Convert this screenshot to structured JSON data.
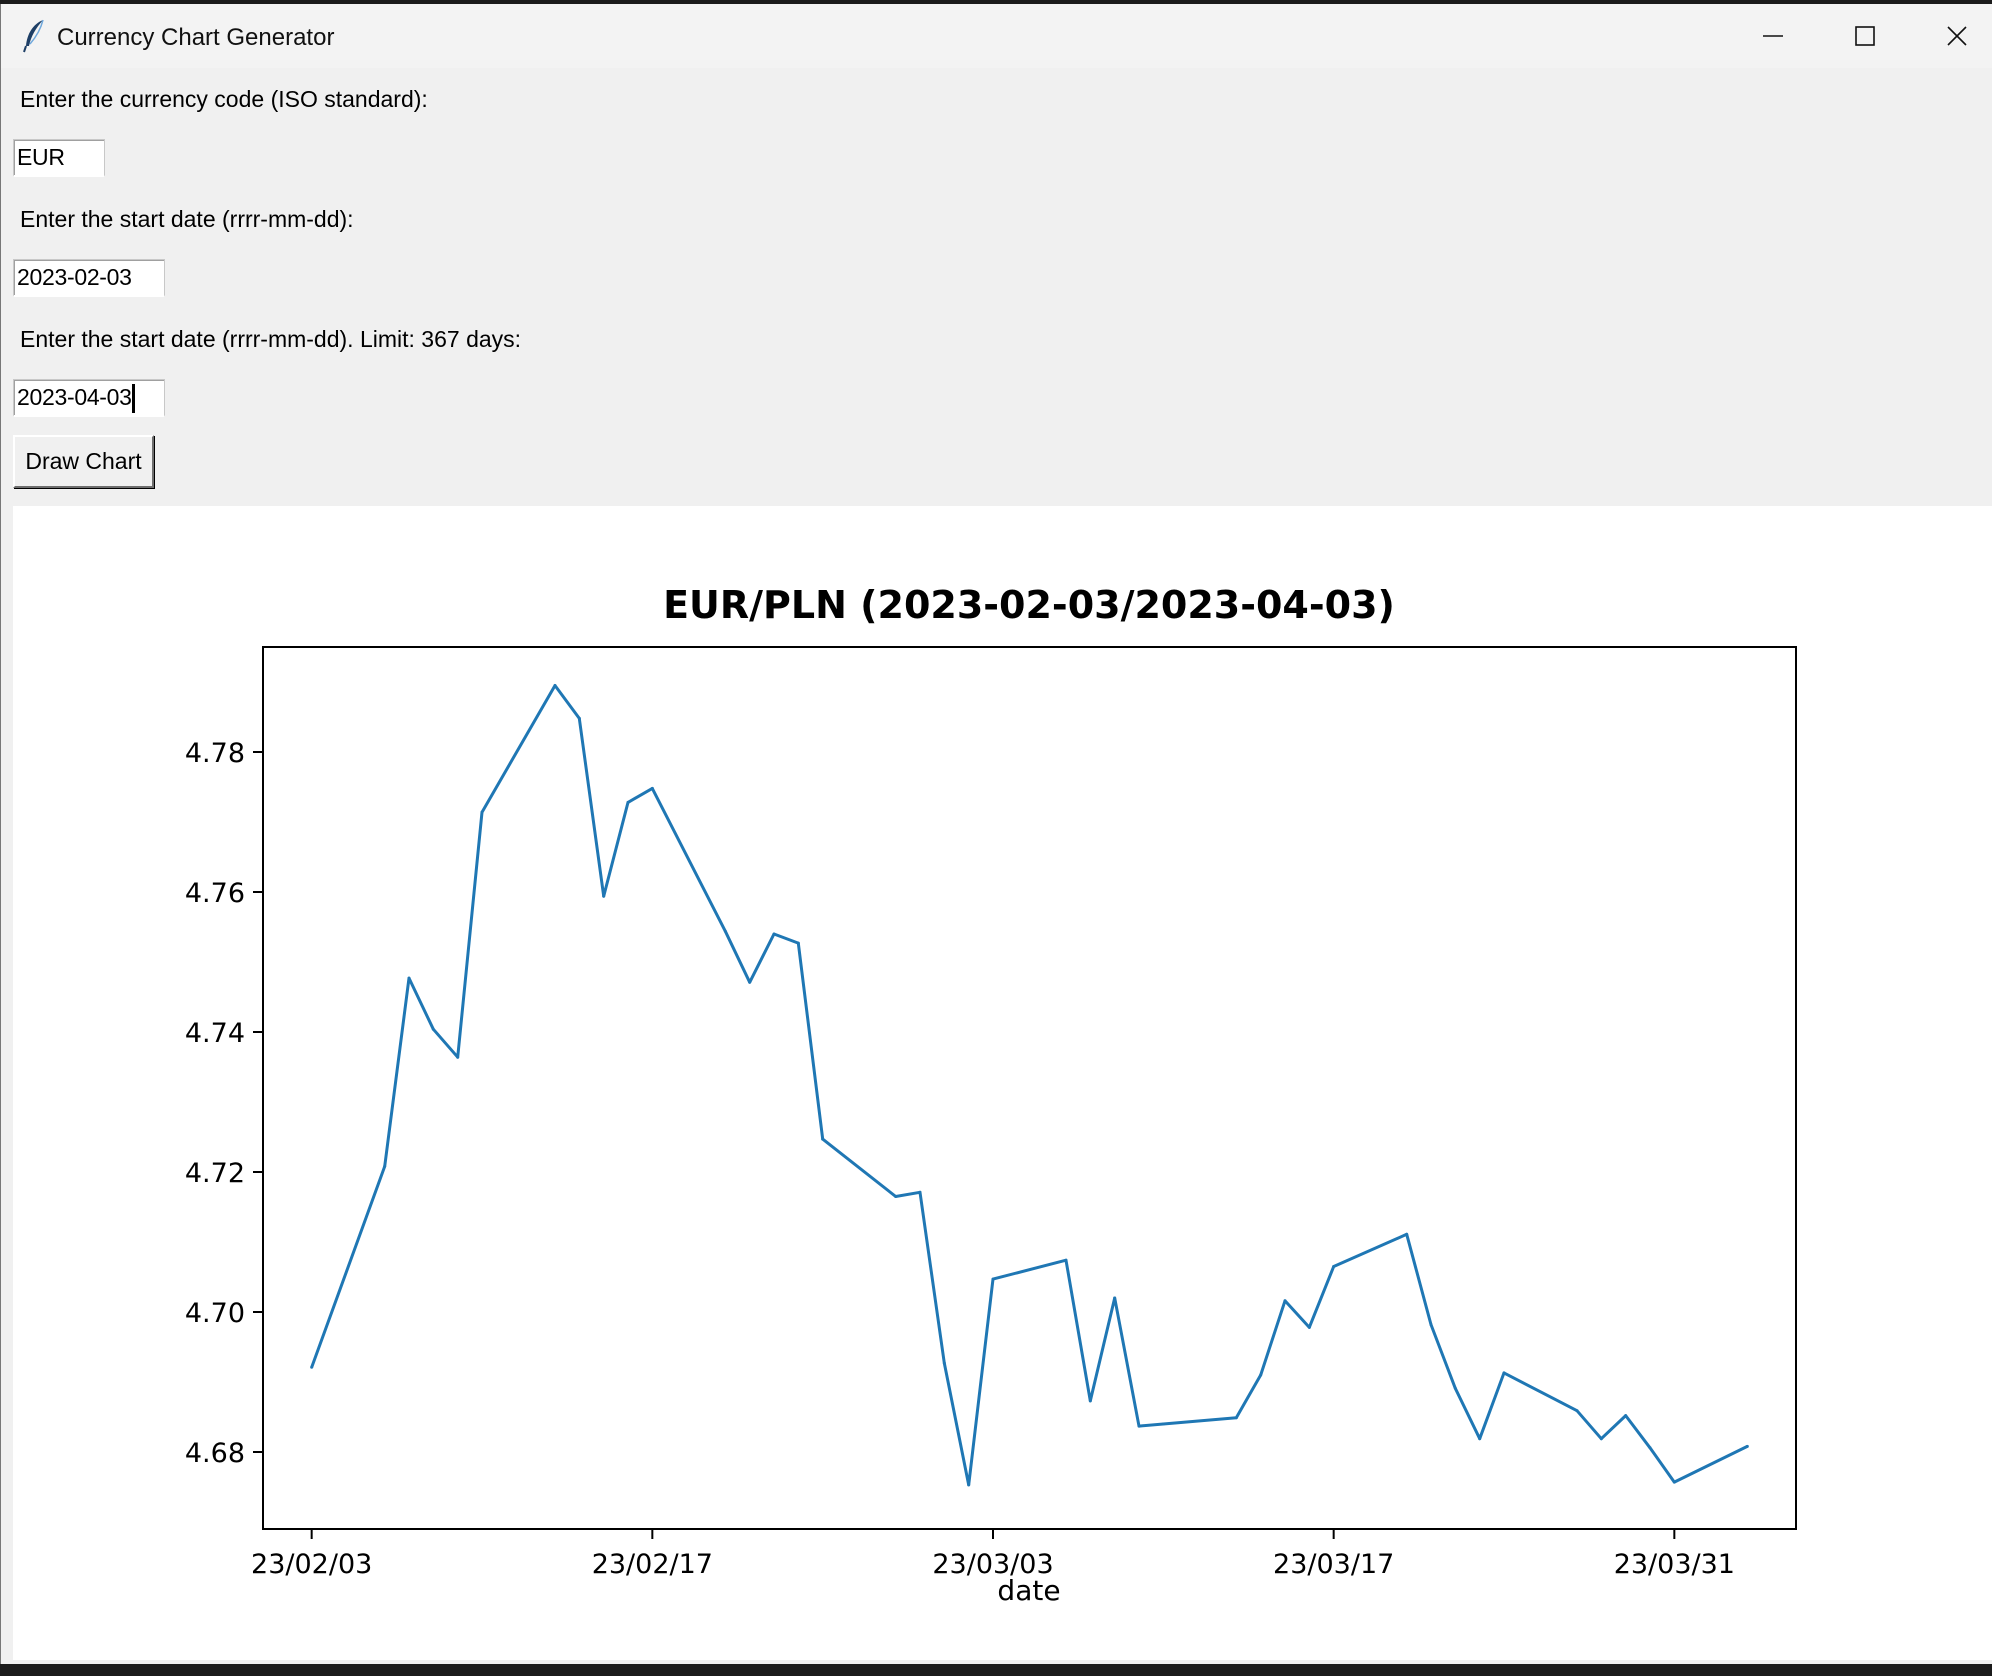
{
  "window": {
    "title": "Currency Chart Generator",
    "icon": "feather-icon",
    "controls": [
      "minimize-icon",
      "maximize-icon",
      "close-icon"
    ]
  },
  "form": {
    "currency_label": "Enter the currency code (ISO standard):",
    "currency_value": "EUR",
    "start_label": "Enter the start date (rrrr-mm-dd):",
    "start_value": "2023-02-03",
    "end_label": "Enter the start date (rrrr-mm-dd). Limit: 367 days:",
    "end_value": "2023-04-03",
    "draw_button": "Draw Chart"
  },
  "colors": {
    "series": "#1f77b4",
    "window_bg": "#f0f0f0",
    "canvas_bg": "#ffffff"
  },
  "chart_data": {
    "type": "line",
    "title": "EUR/PLN (2023-02-03/2023-04-03)",
    "xlabel": "date",
    "ylabel": "",
    "x_tick_labels": [
      "23/02/03",
      "23/02/17",
      "23/03/03",
      "23/03/17",
      "23/03/31"
    ],
    "x_tick_dates": [
      "2023-02-03",
      "2023-02-17",
      "2023-03-03",
      "2023-03-17",
      "2023-03-31"
    ],
    "y_ticks": [
      4.68,
      4.7,
      4.72,
      4.74,
      4.76,
      4.78
    ],
    "y_tick_labels": [
      "4.68",
      "4.70",
      "4.72",
      "4.74",
      "4.76",
      "4.78"
    ],
    "xlim": [
      "2023-02-01",
      "2023-04-05"
    ],
    "ylim": [
      4.669,
      4.795
    ],
    "grid": false,
    "series": [
      {
        "x": [
          "2023-02-03",
          "2023-02-06",
          "2023-02-07",
          "2023-02-08",
          "2023-02-09",
          "2023-02-10",
          "2023-02-13",
          "2023-02-14",
          "2023-02-15",
          "2023-02-16",
          "2023-02-17",
          "2023-02-20",
          "2023-02-21",
          "2023-02-22",
          "2023-02-23",
          "2023-02-24",
          "2023-02-27",
          "2023-02-28",
          "2023-03-01",
          "2023-03-02",
          "2023-03-03",
          "2023-03-06",
          "2023-03-07",
          "2023-03-08",
          "2023-03-09",
          "2023-03-10",
          "2023-03-13",
          "2023-03-14",
          "2023-03-15",
          "2023-03-16",
          "2023-03-17",
          "2023-03-20",
          "2023-03-21",
          "2023-03-22",
          "2023-03-23",
          "2023-03-24",
          "2023-03-27",
          "2023-03-28",
          "2023-03-29",
          "2023-03-30",
          "2023-03-31",
          "2023-04-03"
        ],
        "values": [
          4.6921,
          4.7208,
          4.7477,
          4.7404,
          4.7364,
          4.7714,
          4.7895,
          4.7848,
          4.7594,
          4.7728,
          4.7748,
          4.7544,
          4.7471,
          4.754,
          4.7527,
          4.7247,
          4.7165,
          4.7171,
          4.6927,
          4.6753,
          4.7047,
          4.7074,
          4.6873,
          4.702,
          4.6837,
          4.684,
          4.6849,
          4.691,
          4.7016,
          4.6978,
          4.7065,
          4.7111,
          4.6982,
          4.6891,
          4.6819,
          4.6913,
          4.6859,
          4.6819,
          4.6852,
          4.6806,
          4.6757,
          4.6808
        ]
      }
    ]
  }
}
